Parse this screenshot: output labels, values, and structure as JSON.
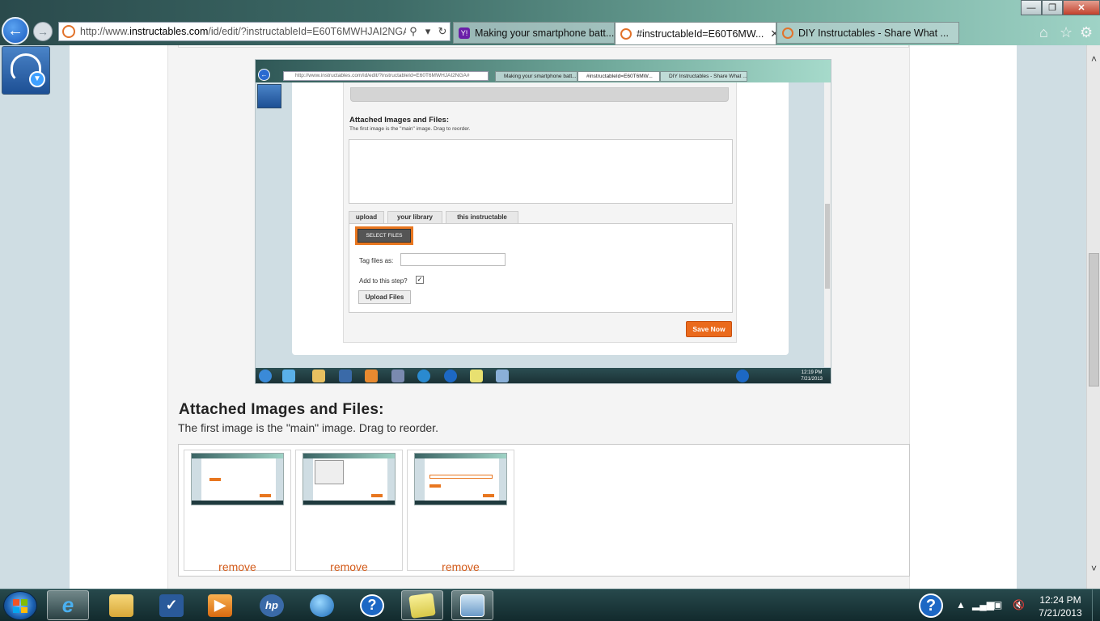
{
  "browser": {
    "url_prefix": "http://www.",
    "url_domain": "instructables.com",
    "url_path": "/id/edit/?instructableId=E60T6MWHJAI2NGA#",
    "tabs": [
      {
        "label": "Making your smartphone batt..."
      },
      {
        "label": "#instructableId=E60T6MW...",
        "close": "✕"
      },
      {
        "label": "DIY Instructables - Share What ..."
      }
    ]
  },
  "embedded": {
    "address": "http://www.instructables.com/id/edit/?instructableId=E60T6MWHJAI2NGA#",
    "tabs": [
      {
        "label": "Making your smartphone batt..."
      },
      {
        "label": "#instructableId=E60T6MW..."
      },
      {
        "label": "DIY Instructables - Share What ..."
      }
    ],
    "heading": "Attached Images and Files:",
    "subtitle": "The first image is the \"main\" image. Drag to reorder.",
    "tab_upload": "upload",
    "tab_library": "your library",
    "tab_this": "this instructable",
    "select_files": "SELECT FILES",
    "tag_label": "Tag files as:",
    "add_label": "Add to this step?",
    "add_check": "✓",
    "upload_button": "Upload Files",
    "save_button": "Save Now",
    "clock_time": "12:19 PM",
    "clock_date": "7/21/2013"
  },
  "attached": {
    "title": "Attached Images and Files:",
    "subtitle": "The first image is the \"main\" image. Drag to reorder.",
    "thumbnails": [
      {
        "remove": "remove"
      },
      {
        "remove": "remove"
      },
      {
        "remove": "remove"
      }
    ]
  },
  "taskbar": {
    "time": "12:24 PM",
    "date": "7/21/2013",
    "help_glyph": "?"
  },
  "colors": {
    "accent_orange": "#e8761f",
    "remove_link": "#d35b1a",
    "taskbar": "#1a3436"
  }
}
